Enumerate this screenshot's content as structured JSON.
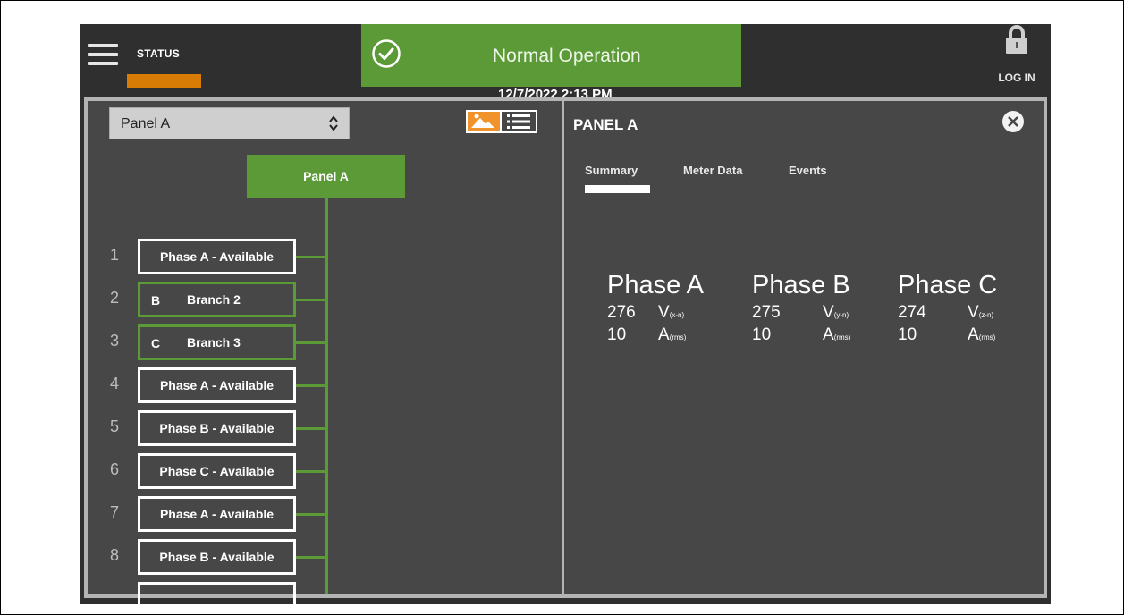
{
  "header": {
    "status_label": "STATUS",
    "status_text": "Normal Operation",
    "datetime": "12/7/2022 2:13 PM",
    "login_label": "LOG IN"
  },
  "colors": {
    "accent_green": "#5b9a36",
    "status_orange": "#d97c06",
    "toggle_orange": "#f0932b",
    "background": "#2f2f2f"
  },
  "left_pane": {
    "panel_select": {
      "selected": "Panel A"
    },
    "root_node": "Panel A",
    "branches": [
      {
        "num": "1",
        "label": "Phase A - Available"
      },
      {
        "num": "2",
        "phase": "B",
        "label": "Branch 2"
      },
      {
        "num": "3",
        "phase": "C",
        "label": "Branch 3"
      },
      {
        "num": "4",
        "label": "Phase A - Available"
      },
      {
        "num": "5",
        "label": "Phase B - Available"
      },
      {
        "num": "6",
        "label": "Phase C - Available"
      },
      {
        "num": "7",
        "label": "Phase A - Available"
      },
      {
        "num": "8",
        "label": "Phase B - Available"
      }
    ]
  },
  "detail": {
    "title": "PANEL A",
    "tabs": [
      "Summary",
      "Meter Data",
      "Events"
    ],
    "active_tab": "Summary",
    "phases": [
      {
        "name": "Phase A",
        "voltage": "276",
        "voltage_unit": "V",
        "voltage_sub": "(x-n)",
        "current": "10",
        "current_unit": "A",
        "current_sub": "(rms)"
      },
      {
        "name": "Phase B",
        "voltage": "275",
        "voltage_unit": "V",
        "voltage_sub": "(y-n)",
        "current": "10",
        "current_unit": "A",
        "current_sub": "(rms)"
      },
      {
        "name": "Phase C",
        "voltage": "274",
        "voltage_unit": "V",
        "voltage_sub": "(z-n)",
        "current": "10",
        "current_unit": "A",
        "current_sub": "(rms)"
      }
    ]
  }
}
